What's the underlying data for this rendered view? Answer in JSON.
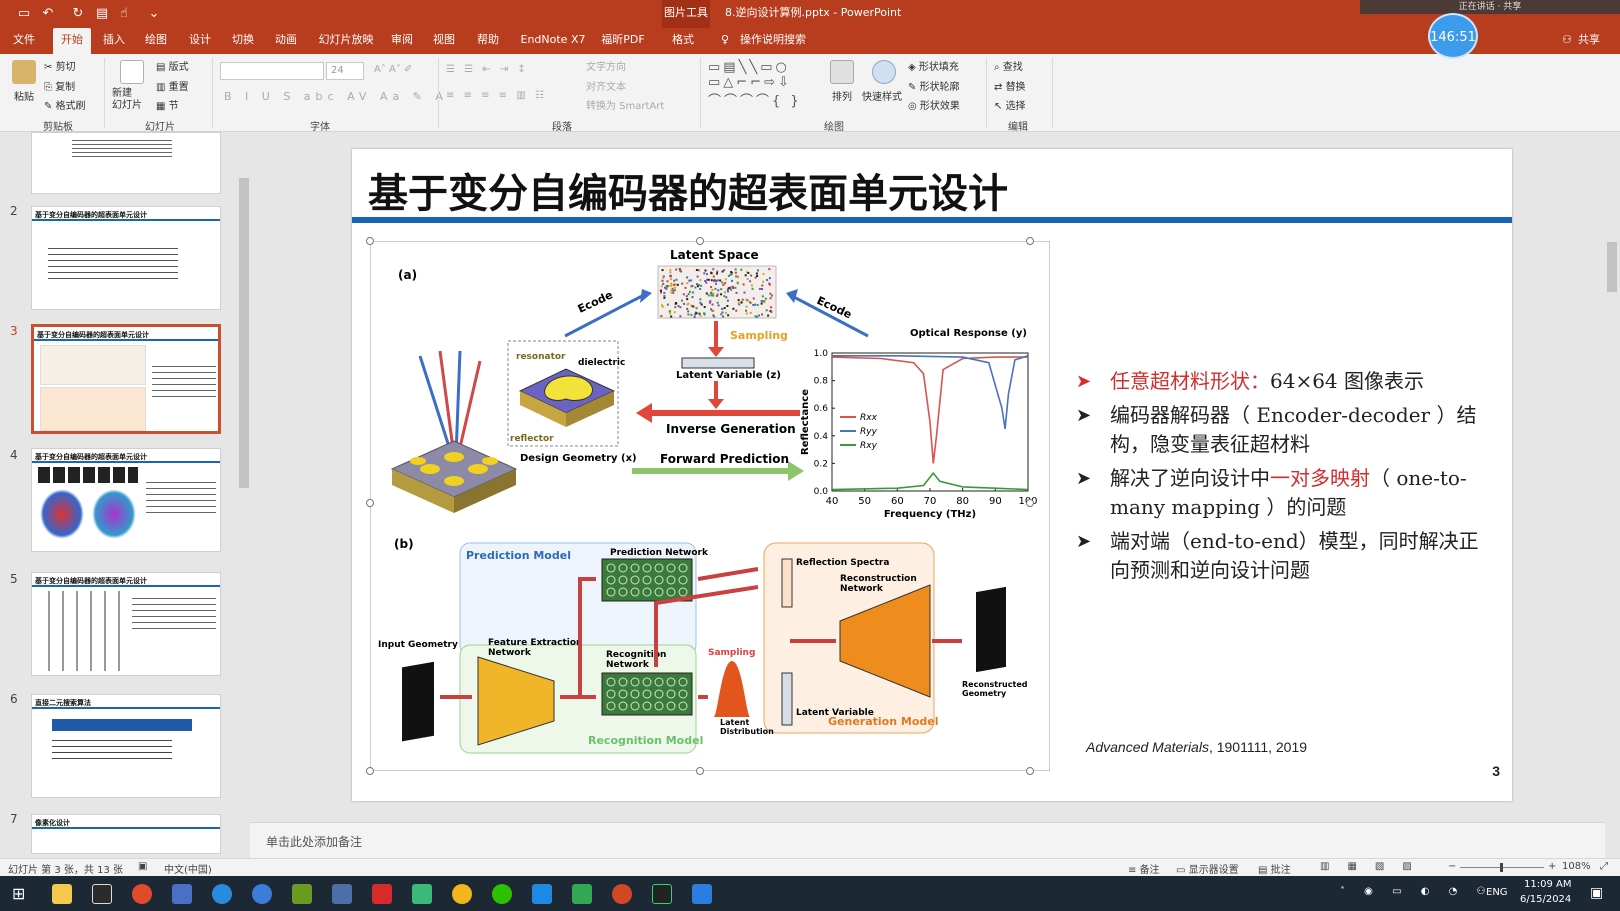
{
  "titlebar": {
    "context_tool": "图片工具",
    "document_title": "8.逆向设计算例.pptx  -  PowerPoint",
    "window_controls": "正在讲话  ·  共享",
    "timer": "146:51"
  },
  "tabs": [
    {
      "label": "文件"
    },
    {
      "label": "开始"
    },
    {
      "label": "插入"
    },
    {
      "label": "绘图"
    },
    {
      "label": "设计"
    },
    {
      "label": "切换"
    },
    {
      "label": "动画"
    },
    {
      "label": "幻灯片放映"
    },
    {
      "label": "审阅"
    },
    {
      "label": "视图"
    },
    {
      "label": "帮助"
    },
    {
      "label": "EndNote X7"
    },
    {
      "label": "福昕PDF"
    },
    {
      "label": "格式"
    }
  ],
  "tell_me": "操作说明搜索",
  "share": "共享",
  "ribbon": {
    "clipboard": {
      "paste": "粘贴",
      "cut": "剪切",
      "copy": "复制",
      "format_painter": "格式刷",
      "group": "剪贴板"
    },
    "slides": {
      "new_slide": "新建\n幻灯片",
      "layout": "版式",
      "reset": "重置",
      "section": "节",
      "group": "幻灯片"
    },
    "font": {
      "font_size": "24",
      "group": "字体"
    },
    "paragraph": {
      "text_direction": "文字方向",
      "align_text": "对齐文本",
      "convert_smartart": "转换为 SmartArt",
      "group": "段落"
    },
    "drawing": {
      "arrange": "排列",
      "quick_styles": "快速样式",
      "shape_fill": "形状填充",
      "shape_outline": "形状轮廓",
      "shape_effects": "形状效果",
      "group": "绘图"
    },
    "editing": {
      "find": "查找",
      "replace": "替换",
      "select": "选择",
      "group": "编辑"
    }
  },
  "thumbnails": [
    {
      "num": "",
      "title": ""
    },
    {
      "num": "2",
      "title": "基于变分自编码器的超表面单元设计"
    },
    {
      "num": "3",
      "title": "基于变分自编码器的超表面单元设计"
    },
    {
      "num": "4",
      "title": "基于变分自编码器的超表面单元设计"
    },
    {
      "num": "5",
      "title": "基于变分自编码器的超表面单元设计"
    },
    {
      "num": "6",
      "title": "直接二元搜索算法"
    },
    {
      "num": "7",
      "title": "像素化设计"
    }
  ],
  "slide": {
    "title": "基于变分自编码器的超表面单元设计",
    "bullets": [
      {
        "highlight": "任意超材料形状：",
        "text": "64×64 图像表示"
      },
      {
        "highlight": "",
        "text": "编码器解码器（ Encoder-decoder ）结构，隐变量表征超材料"
      },
      {
        "pre": "解决了逆向设计中",
        "highlight": "一对多映射",
        "text": "（ one-to-many mapping ）的问题"
      },
      {
        "highlight": "",
        "text": "端对端（end-to-end）模型，同时解决正向预测和逆向设计问题"
      }
    ],
    "citation_journal": "Advanced Materials",
    "citation_rest": ", 1901111, 2019",
    "page_number": "3"
  },
  "figure": {
    "a_label": "(a)",
    "b_label": "(b)",
    "latent_space": "Latent Space",
    "encode_left": "Ecode",
    "encode_right": "Ecode",
    "sampling": "Sampling",
    "latent_variable": "Latent Variable (z)",
    "inverse_generation": "Inverse Generation",
    "forward_prediction": "Forward Prediction",
    "design_geometry": "Design Geometry (x)",
    "resonator": "resonator",
    "dielectric": "dielectric",
    "reflector": "reflector",
    "optical_response": "Optical Response (y)",
    "prediction_model": "Prediction Model",
    "prediction_network": "Prediction Network",
    "feature_extraction": "Feature Extraction\nNetwork",
    "recognition_network": "Recognition\nNetwork",
    "recognition_model": "Recognition Model",
    "input_geometry": "Input Geometry",
    "sampling_b": "Sampling",
    "latent_distribution": "Latent\nDistribution",
    "reflection_spectra": "Reflection Spectra",
    "reconstruction_network": "Reconstruction\nNetwork",
    "latent_variable_b": "Latent Variable",
    "generation_model": "Generation Model",
    "reconstructed_geometry": "Reconstructed\nGeometry"
  },
  "chart_data": {
    "type": "line",
    "title": "",
    "xlabel": "Frequency (THz)",
    "ylabel": "Reflectance",
    "xlim": [
      40,
      100
    ],
    "ylim": [
      0.0,
      1.0
    ],
    "xticks": [
      40,
      50,
      60,
      70,
      80,
      90,
      100
    ],
    "yticks": [
      0.0,
      0.2,
      0.4,
      0.6,
      0.8,
      1.0
    ],
    "legend": "top-left",
    "series": [
      {
        "name": "Rxx",
        "color": "#d9534f",
        "x": [
          40,
          55,
          65,
          68,
          70,
          71,
          72,
          74,
          80,
          90,
          100
        ],
        "y": [
          0.97,
          0.96,
          0.93,
          0.85,
          0.5,
          0.2,
          0.4,
          0.88,
          0.96,
          0.97,
          0.97
        ]
      },
      {
        "name": "Ryy",
        "color": "#4a72c0",
        "x": [
          40,
          60,
          80,
          88,
          92,
          93,
          94,
          96,
          100
        ],
        "y": [
          0.98,
          0.98,
          0.97,
          0.93,
          0.6,
          0.45,
          0.7,
          0.95,
          0.98
        ]
      },
      {
        "name": "Rxy",
        "color": "#3a9a3a",
        "x": [
          40,
          60,
          68,
          70,
          71,
          73,
          80,
          90,
          100
        ],
        "y": [
          0.01,
          0.02,
          0.04,
          0.1,
          0.13,
          0.07,
          0.03,
          0.02,
          0.01
        ]
      }
    ]
  },
  "notes": {
    "placeholder": "单击此处添加备注"
  },
  "statusbar": {
    "slide_info": "幻灯片 第 3 张，共 13 张",
    "language": "中文(中国)",
    "notes": "备注",
    "display_settings": "显示器设置",
    "comments": "批注",
    "zoom": "108%"
  },
  "taskbar": {
    "lang": "ENG",
    "time": "11:09 AM",
    "date": "6/15/2024"
  }
}
